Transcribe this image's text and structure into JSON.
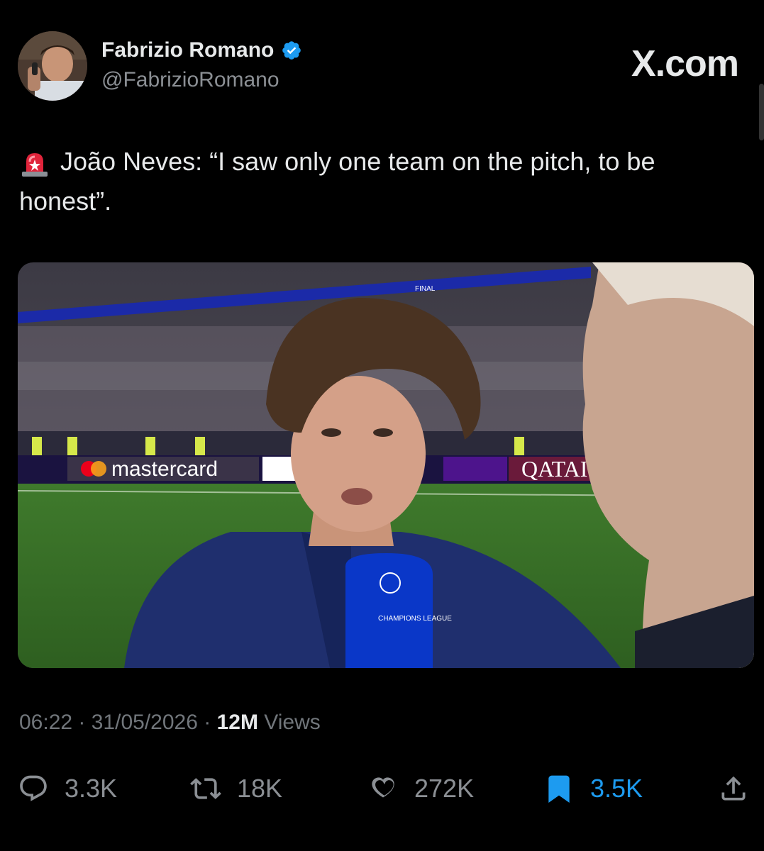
{
  "author": {
    "name": "Fabrizio Romano",
    "handle": "@FabrizioRomano",
    "verified": true
  },
  "brand": {
    "label": "X.com"
  },
  "tweet": {
    "emoji": "siren-icon",
    "text": "João Neves: “I saw only one team on the pitch, to be honest”."
  },
  "media": {
    "banner_text_mastercard": "mastercard",
    "banner_text_qatar": "QATAI",
    "mic_text": "CHAMPIONS LEAGUE",
    "board_final": "FINAL"
  },
  "meta": {
    "time": "06:22",
    "date": "31/05/2026",
    "views_count": "12M",
    "views_label": "Views"
  },
  "actions": {
    "replies": "3.3K",
    "reposts": "18K",
    "likes": "272K",
    "bookmarks": "3.5K"
  },
  "colors": {
    "accent": "#1d9bf0",
    "background": "#000000",
    "muted": "#71767b"
  }
}
